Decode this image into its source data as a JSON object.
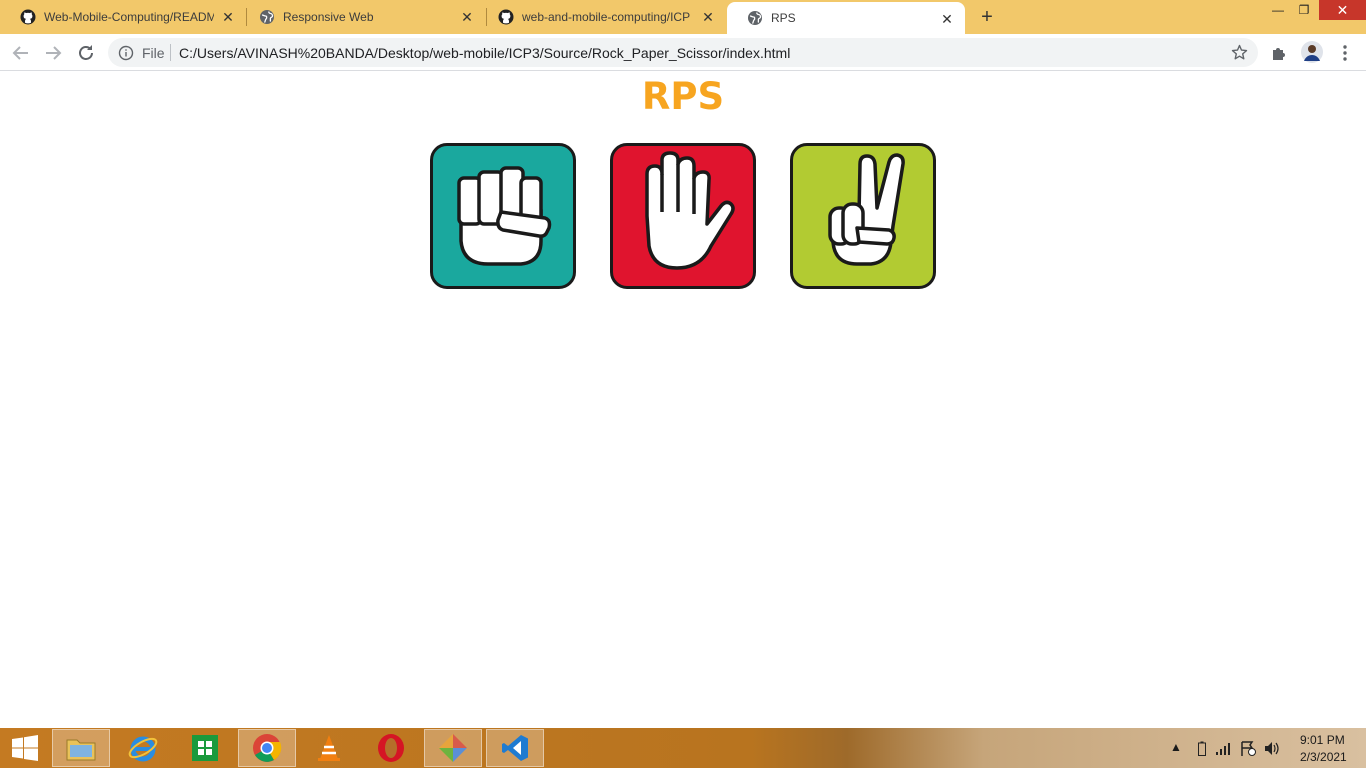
{
  "browser": {
    "tabs": [
      {
        "title": "Web-Mobile-Computing/README",
        "favicon": "github-icon",
        "active": false
      },
      {
        "title": "Responsive Web",
        "favicon": "globe-icon",
        "active": false
      },
      {
        "title": "web-and-mobile-computing/ICP",
        "favicon": "github-icon",
        "active": false
      },
      {
        "title": "RPS",
        "favicon": "globe-icon",
        "active": true
      }
    ],
    "address": {
      "scheme_label": "File",
      "url": "C:/Users/AVINASH%20BANDA/Desktop/web-mobile/ICP3/Source/Rock_Paper_Scissor/index.html"
    }
  },
  "page": {
    "title": "RPS",
    "title_color": "#f7a520",
    "choices": [
      {
        "name": "rock",
        "icon": "fist-icon",
        "color": "#1aa89e"
      },
      {
        "name": "paper",
        "icon": "open-hand-icon",
        "color": "#e0142e"
      },
      {
        "name": "scissors",
        "icon": "peace-hand-icon",
        "color": "#b2cb32"
      }
    ]
  },
  "taskbar": {
    "apps": [
      "start-button",
      "file-explorer",
      "internet-explorer",
      "store",
      "chrome",
      "vlc",
      "opera",
      "git",
      "vs-code"
    ],
    "clock_time": "9:01 PM",
    "clock_date": "2/3/2021"
  }
}
